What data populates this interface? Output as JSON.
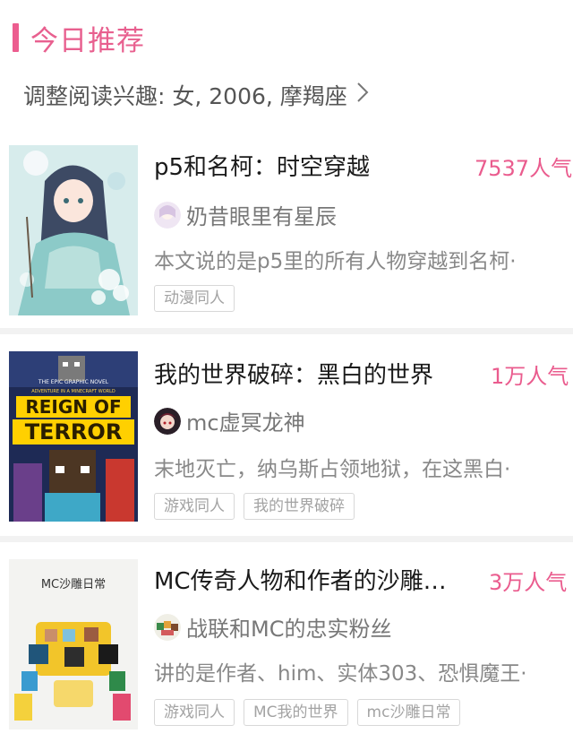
{
  "header": {
    "title": "今日推荐"
  },
  "interest": {
    "text": "调整阅读兴趣: 女, 2006, 摩羯座"
  },
  "icons": {
    "chevron": "chevron-right-icon"
  },
  "books": [
    {
      "title": "p5和名柯：时空穿越",
      "popularity": "7537人气",
      "author": "奶昔眼里有星辰",
      "summary": "本文说的是p5里的所有人物穿越到名柯·",
      "tags": [
        "动漫同人"
      ]
    },
    {
      "title": "我的世界破碎：黑白的世界",
      "popularity": "1万人气",
      "author": "mc虚冥龙神",
      "summary": "末地灭亡，纳乌斯占领地狱，在这黑白·",
      "tags": [
        "游戏同人",
        "我的世界破碎"
      ],
      "cover_text": {
        "line1": "THE EPIC GRAPHIC NOVEL",
        "line2": "ADVENTURE IN A MINECRAFT WORLD",
        "line3": "REIGN OF",
        "line4": "TERROR"
      }
    },
    {
      "title": "MC传奇人物和作者的沙雕…",
      "popularity": "3万人气",
      "author": "战联和MC的忠实粉丝",
      "summary": "讲的是作者、him、实体303、恐惧魔王·",
      "tags": [
        "游戏同人",
        "MC我的世界",
        "mc沙雕日常"
      ],
      "cover_text": {
        "title": "MC沙雕日常"
      }
    }
  ],
  "colors": {
    "accent": "#e8608f",
    "divider": "#f2f2f2"
  }
}
